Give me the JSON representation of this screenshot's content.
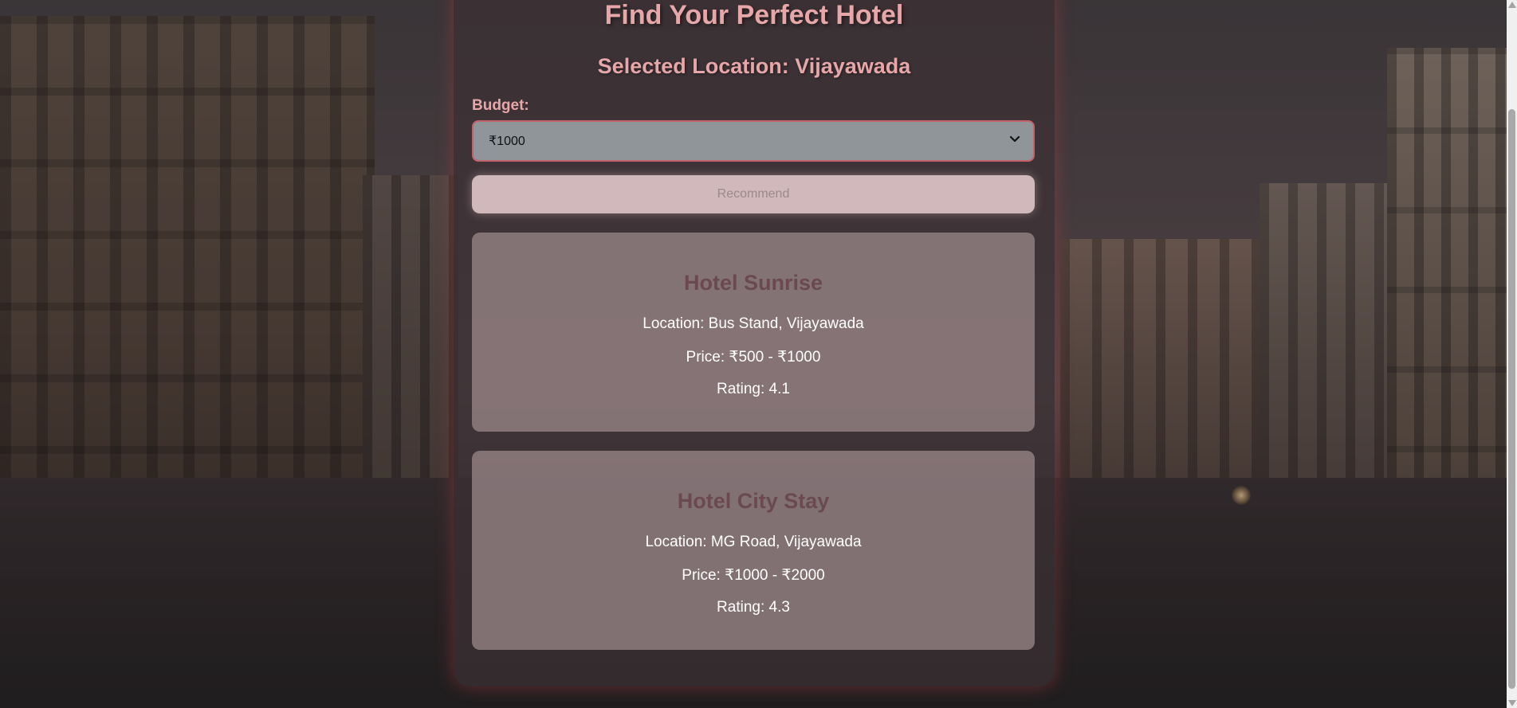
{
  "page": {
    "title": "Find Your Perfect Hotel",
    "selected_location": "Selected Location: Vijayawada"
  },
  "form": {
    "budget_label": "Budget:",
    "budget_selected": "₹1000",
    "recommend_label": "Recommend"
  },
  "hotels": [
    {
      "name": "Hotel Sunrise",
      "location": "Location: Bus Stand, Vijayawada",
      "price": "Price: ₹500 - ₹1000",
      "rating": "Rating: 4.1"
    },
    {
      "name": "Hotel City Stay",
      "location": "Location: MG Road, Vijayawada",
      "price": "Price: ₹1000 - ₹2000",
      "rating": "Rating: 4.3"
    }
  ],
  "colors": {
    "accent_pink": "#e7a6a8",
    "select_border": "#c2636a",
    "hotel_name": "#6a4a50"
  },
  "icons": {
    "select_arrow": "chevron-down-icon"
  }
}
